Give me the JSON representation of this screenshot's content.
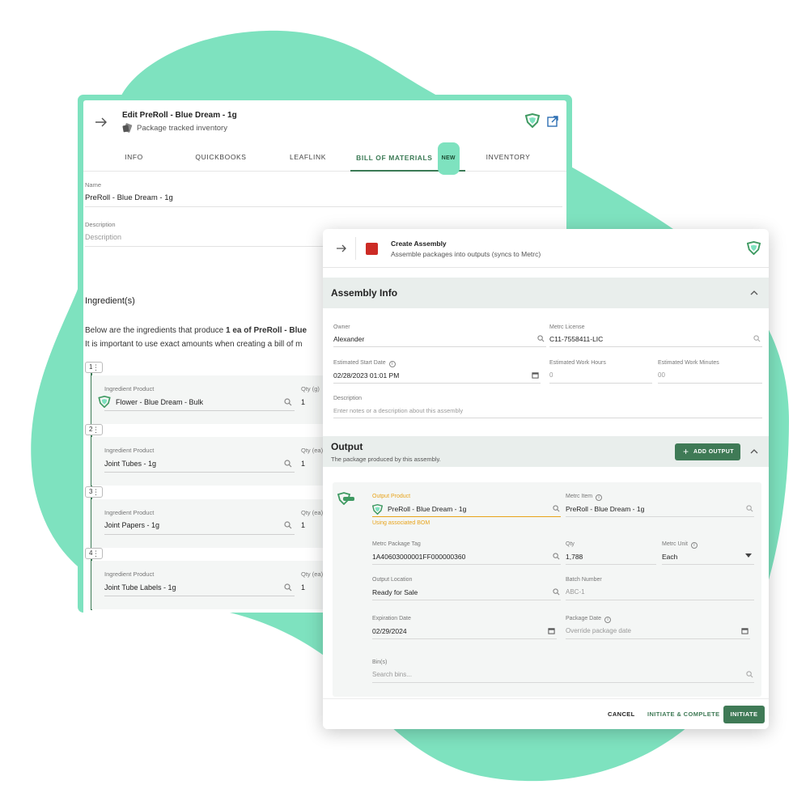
{
  "colors": {
    "accent": "#3f7a56",
    "mint": "#7ee2bf",
    "warning": "#e8a31a",
    "stop": "#cc2b25"
  },
  "back_window": {
    "title": "Edit PreRoll - Blue Dream - 1g",
    "subtitle": "Package tracked inventory",
    "tabs": [
      {
        "label": "INFO"
      },
      {
        "label": "QUICKBOOKS"
      },
      {
        "label": "LEAFLINK"
      },
      {
        "label": "BILL OF MATERIALS",
        "badge": "NEW",
        "active": true
      },
      {
        "label": "INVENTORY"
      }
    ],
    "name_label": "Name",
    "name_value": "PreRoll - Blue Dream - 1g",
    "description_label": "Description",
    "description_placeholder": "Description",
    "ingredients_title": "Ingredient(s)",
    "ingredients_desc_1a": "Below are the ingredients that produce ",
    "ingredients_desc_1b": "1 ea of PreRoll - Blue",
    "ingredients_desc_2": "It is important to use exact amounts when creating a bill of m",
    "ingredients": [
      {
        "num": "1",
        "label": "Ingredient Product",
        "product": "Flower - Blue Dream - Bulk",
        "qty_label": "Qty (g)",
        "qty": "1"
      },
      {
        "num": "2",
        "label": "Ingredient Product",
        "product": "Joint Tubes - 1g",
        "qty_label": "Qty (ea)",
        "qty": "1"
      },
      {
        "num": "3",
        "label": "Ingredient Product",
        "product": "Joint Papers - 1g",
        "qty_label": "Qty (ea)",
        "qty": "1"
      },
      {
        "num": "4",
        "label": "Ingredient Product",
        "product": "Joint Tube Labels - 1g",
        "qty_label": "Qty (ea)",
        "qty": "1"
      }
    ]
  },
  "front_window": {
    "title": "Create Assembly",
    "subtitle": "Assemble packages into outputs (syncs to Metrc)",
    "assembly_info": {
      "heading": "Assembly Info",
      "owner_label": "Owner",
      "owner_value": "Alexander",
      "license_label": "Metrc License",
      "license_value": "C11-7558411-LIC",
      "start_label": "Estimated Start Date",
      "start_value": "02/28/2023 01:01 PM",
      "hours_label": "Estimated Work Hours",
      "hours_placeholder": "0",
      "minutes_label": "Estimated Work Minutes",
      "minutes_placeholder": "00",
      "desc_label": "Description",
      "desc_placeholder": "Enter notes or a description about this assembly"
    },
    "output": {
      "heading": "Output",
      "subheading": "The package produced by this assembly.",
      "add_button": "ADD OUTPUT",
      "product_label": "Output Product",
      "product_value": "PreRoll - Blue Dream - 1g",
      "product_hint": "Using associated BOM",
      "item_label": "Metrc Item",
      "item_value": "PreRoll - Blue Dream - 1g",
      "tag_label": "Metrc Package Tag",
      "tag_value": "1A40603000001FF000000360",
      "qty_label": "Qty",
      "qty_value": "1,788",
      "unit_label": "Metrc Unit",
      "unit_value": "Each",
      "location_label": "Output Location",
      "location_value": "Ready for Sale",
      "batch_label": "Batch Number",
      "batch_placeholder": "ABC-1",
      "expiration_label": "Expiration Date",
      "expiration_value": "02/29/2024",
      "package_date_label": "Package Date",
      "package_date_placeholder": "Override package date",
      "bins_label": "Bin(s)",
      "bins_placeholder": "Search bins..."
    },
    "footer": {
      "cancel": "CANCEL",
      "initiate_complete": "INITIATE & COMPLETE",
      "initiate": "INITIATE"
    }
  }
}
